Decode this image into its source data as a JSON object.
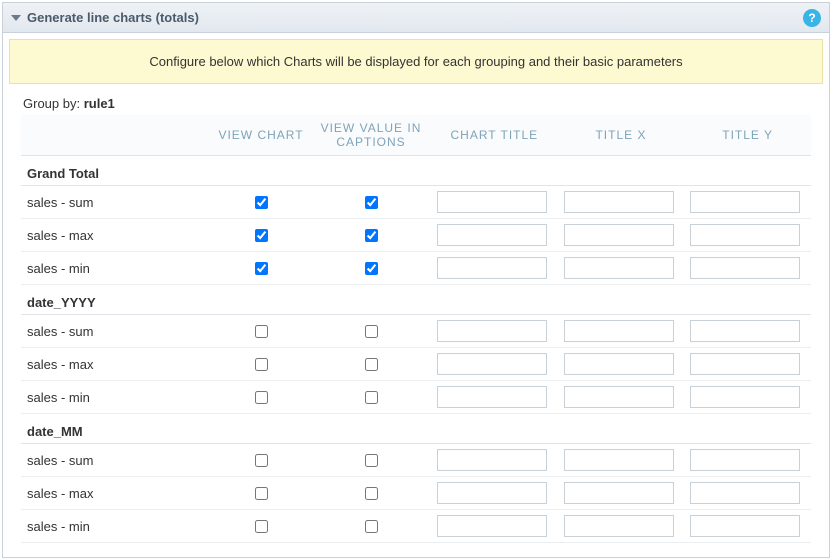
{
  "panel": {
    "title": "Generate line charts (totals)",
    "help_glyph": "?"
  },
  "info": "Configure below which Charts will be displayed for each grouping and their basic parameters",
  "groupby_label": "Group by:",
  "groupby_value": "rule1",
  "columns": {
    "label": "",
    "view_chart": "VIEW CHART",
    "view_value": "VIEW VALUE IN CAPTIONS",
    "chart_title": "CHART TITLE",
    "title_x": "TITLE X",
    "title_y": "TITLE Y"
  },
  "sections": [
    {
      "name": "Grand Total",
      "rows": [
        {
          "label": "sales - sum",
          "view_chart": true,
          "view_value": true,
          "chart_title": "",
          "title_x": "",
          "title_y": ""
        },
        {
          "label": "sales - max",
          "view_chart": true,
          "view_value": true,
          "chart_title": "",
          "title_x": "",
          "title_y": ""
        },
        {
          "label": "sales - min",
          "view_chart": true,
          "view_value": true,
          "chart_title": "",
          "title_x": "",
          "title_y": ""
        }
      ]
    },
    {
      "name": "date_YYYY",
      "rows": [
        {
          "label": "sales - sum",
          "view_chart": false,
          "view_value": false,
          "chart_title": "",
          "title_x": "",
          "title_y": ""
        },
        {
          "label": "sales - max",
          "view_chart": false,
          "view_value": false,
          "chart_title": "",
          "title_x": "",
          "title_y": ""
        },
        {
          "label": "sales - min",
          "view_chart": false,
          "view_value": false,
          "chart_title": "",
          "title_x": "",
          "title_y": ""
        }
      ]
    },
    {
      "name": "date_MM",
      "rows": [
        {
          "label": "sales - sum",
          "view_chart": false,
          "view_value": false,
          "chart_title": "",
          "title_x": "",
          "title_y": ""
        },
        {
          "label": "sales - max",
          "view_chart": false,
          "view_value": false,
          "chart_title": "",
          "title_x": "",
          "title_y": ""
        },
        {
          "label": "sales - min",
          "view_chart": false,
          "view_value": false,
          "chart_title": "",
          "title_x": "",
          "title_y": ""
        }
      ]
    }
  ]
}
